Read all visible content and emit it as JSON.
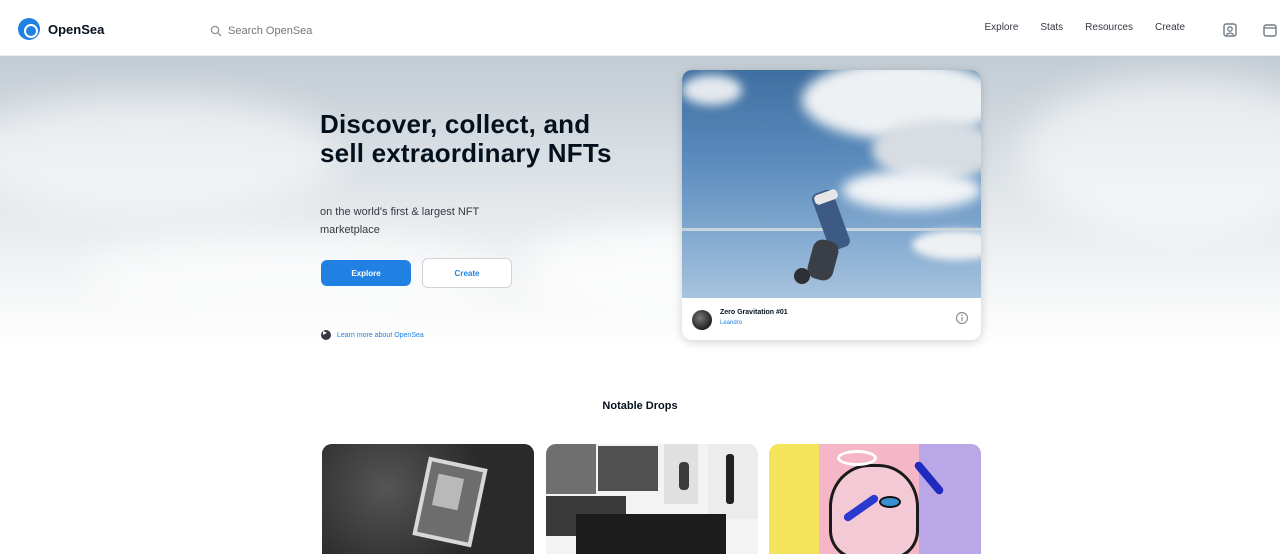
{
  "header": {
    "logo_text": "OpenSea",
    "search_placeholder": "Search OpenSea",
    "nav": [
      "Explore",
      "Stats",
      "Resources",
      "Create"
    ],
    "icons": [
      "profile-icon",
      "wallet-icon"
    ]
  },
  "hero": {
    "title": "Discover, collect, and sell extraordinary NFTs",
    "subtitle": "on the world's first & largest NFT marketplace",
    "explore_label": "Explore",
    "create_label": "Create",
    "learn_more": "Learn more about OpenSea"
  },
  "featured": {
    "name": "Zero Gravitation #01",
    "creator": "Leandro"
  },
  "notable": {
    "title": "Notable Drops"
  },
  "colors": {
    "brand_blue": "#2081e2",
    "text_dark": "#04111d"
  }
}
